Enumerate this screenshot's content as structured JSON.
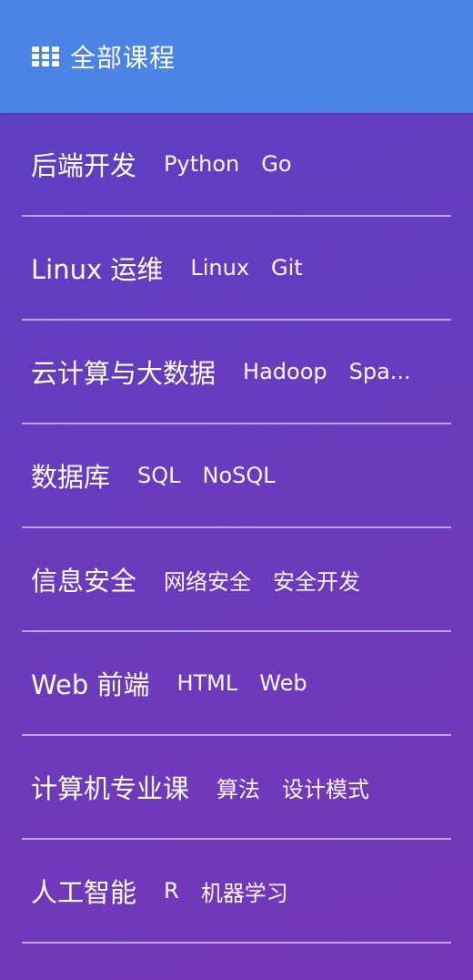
{
  "header": {
    "icon": "grid-icon",
    "title": "全部课程"
  },
  "categories": [
    {
      "title": "后端开发",
      "tags": [
        "Python",
        "Go"
      ]
    },
    {
      "title": "Linux 运维",
      "tags": [
        "Linux",
        "Git"
      ]
    },
    {
      "title": "云计算与大数据",
      "tags": [
        "Hadoop",
        "Spa..."
      ]
    },
    {
      "title": "数据库",
      "tags": [
        "SQL",
        "NoSQL"
      ]
    },
    {
      "title": "信息安全",
      "tags": [
        "网络安全",
        "安全开发"
      ]
    },
    {
      "title": "Web 前端",
      "tags": [
        "HTML",
        "Web"
      ]
    },
    {
      "title": "计算机专业课",
      "tags": [
        "算法",
        "设计模式"
      ]
    },
    {
      "title": "人工智能",
      "tags": [
        "R",
        "机器学习"
      ]
    }
  ],
  "colors": {
    "header_bg": "#4a84e6",
    "body_gradient_start": "#5b3fc4",
    "body_gradient_end": "#7636b8"
  }
}
